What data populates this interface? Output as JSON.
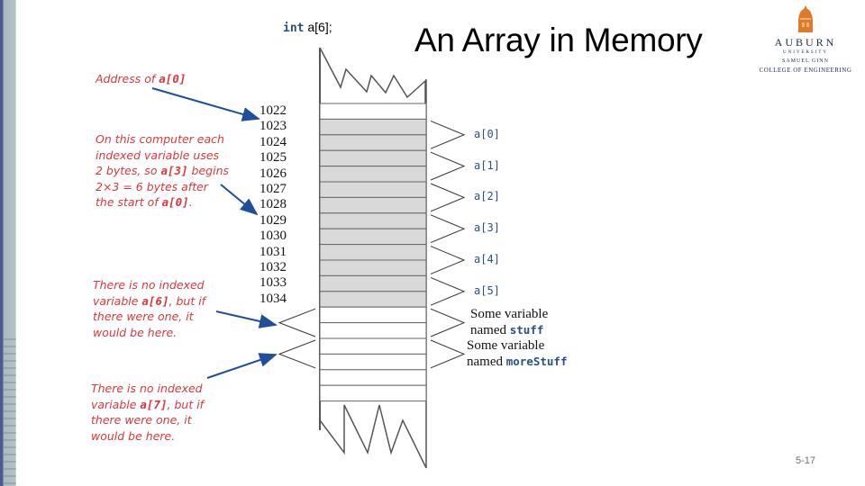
{
  "slide": {
    "title": "An Array in Memory",
    "slide_number": "5-17"
  },
  "declaration": {
    "keyword": "int",
    "rest": " a[6];"
  },
  "logo": {
    "name": "AUBURN",
    "university": "UNIVERSITY",
    "line1": "SAMUEL GINN",
    "line2": "COLLEGE OF ENGINEERING"
  },
  "annotations": {
    "address_of_a0": {
      "prefix": "Address of ",
      "code": "a[0]"
    },
    "bytes_note": {
      "line1": "On this computer each",
      "line2": "indexed variable uses",
      "line3_prefix": "2 bytes, so ",
      "line3_code": "a[3]",
      "line3_suffix": " begins",
      "line4": "2×3 = 6 bytes after",
      "line5_prefix": "the start of ",
      "line5_code": "a[0]",
      "line5_suffix": "."
    },
    "no_a6": {
      "line1": "There is no indexed",
      "line2_prefix": "variable ",
      "line2_code": "a[6]",
      "line2_suffix": ", but if",
      "line3": "there were one, it",
      "line4": "would be here."
    },
    "no_a7": {
      "line1": "There is no indexed",
      "line2_prefix": "variable ",
      "line2_code": "a[7]",
      "line2_suffix": ", but if",
      "line3": "there were one, it",
      "line4": "would be here."
    }
  },
  "memory": {
    "addresses": [
      "1022",
      "1023",
      "1024",
      "1025",
      "1026",
      "1027",
      "1028",
      "1029",
      "1030",
      "1031",
      "1032",
      "1033",
      "1034"
    ],
    "element_labels": [
      "a[0]",
      "a[1]",
      "a[2]",
      "a[3]",
      "a[4]",
      "a[5]"
    ],
    "shaded_cell_color": "#d9d9d9",
    "other_vars": [
      {
        "prefix": "Some variable",
        "named": "named ",
        "code": "stuff"
      },
      {
        "prefix": "Some variable",
        "named": "named ",
        "code": "moreStuff"
      }
    ]
  },
  "colors": {
    "annotation_red": "#d9383a",
    "arrow_blue": "#1f4e9c",
    "code_blue": "#2a4f86",
    "logo_orange": "#e07a2a",
    "logo_navy": "#1b2a4a"
  }
}
